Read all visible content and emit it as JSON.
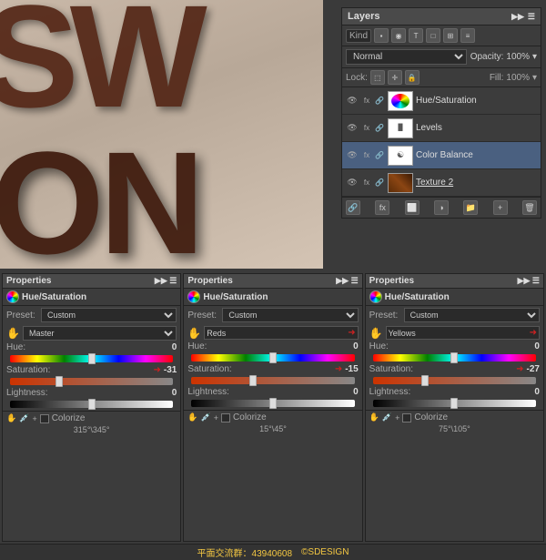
{
  "canvas": {
    "sw_text": "SW",
    "on_text": "ON"
  },
  "layers": {
    "title": "Layers",
    "kind_label": "Kind",
    "mode": "Normal",
    "opacity_label": "Opacity:",
    "opacity_value": "100%",
    "lock_label": "Lock:",
    "fill_label": "Fill:",
    "fill_value": "100%",
    "items": [
      {
        "name": "Hue/Saturation",
        "type": "adjustment",
        "visible": true
      },
      {
        "name": "Levels",
        "type": "adjustment",
        "visible": true
      },
      {
        "name": "Color Balance",
        "type": "adjustment",
        "visible": true
      },
      {
        "name": "Texture 2",
        "type": "texture",
        "visible": true,
        "underline": true
      }
    ]
  },
  "properties": [
    {
      "title": "Properties",
      "panel_title": "Hue/Saturation",
      "preset_label": "Preset:",
      "preset_value": "Custom",
      "channel_label": "",
      "channel_value": "Master",
      "channel_arrow": false,
      "hue_label": "Hue:",
      "hue_value": "0",
      "hue_pos": "50%",
      "sat_label": "Saturation:",
      "sat_value": "-31",
      "sat_pos": "30%",
      "light_label": "Lightness:",
      "light_value": "0",
      "light_pos": "50%",
      "colorize": "Colorize",
      "angle_text": "315°\\345°"
    },
    {
      "title": "Properties",
      "panel_title": "Hue/Saturation",
      "preset_label": "Preset:",
      "preset_value": "Custom",
      "channel_label": "",
      "channel_value": "Reds",
      "channel_arrow": true,
      "hue_label": "Hue:",
      "hue_value": "0",
      "hue_pos": "50%",
      "sat_label": "Saturation:",
      "sat_value": "-15",
      "sat_pos": "38%",
      "light_label": "Lightness:",
      "light_value": "0",
      "light_pos": "50%",
      "colorize": "Colorize",
      "angle_text": "15°\\45°"
    },
    {
      "title": "Properties",
      "panel_title": "Hue/Saturation",
      "preset_label": "Preset:",
      "preset_value": "Custom",
      "channel_label": "",
      "channel_value": "Yellows",
      "channel_arrow": true,
      "hue_label": "Hue:",
      "hue_value": "0",
      "hue_pos": "50%",
      "sat_label": "Saturation:",
      "sat_value": "-27",
      "sat_pos": "32%",
      "light_label": "Lightness:",
      "light_value": "0",
      "light_pos": "50%",
      "colorize": "Colorize",
      "angle_text": "75°\\105°"
    }
  ],
  "bottom_bar": {
    "group": "平面交流群：43940608",
    "brand": "©SDESIGN"
  }
}
